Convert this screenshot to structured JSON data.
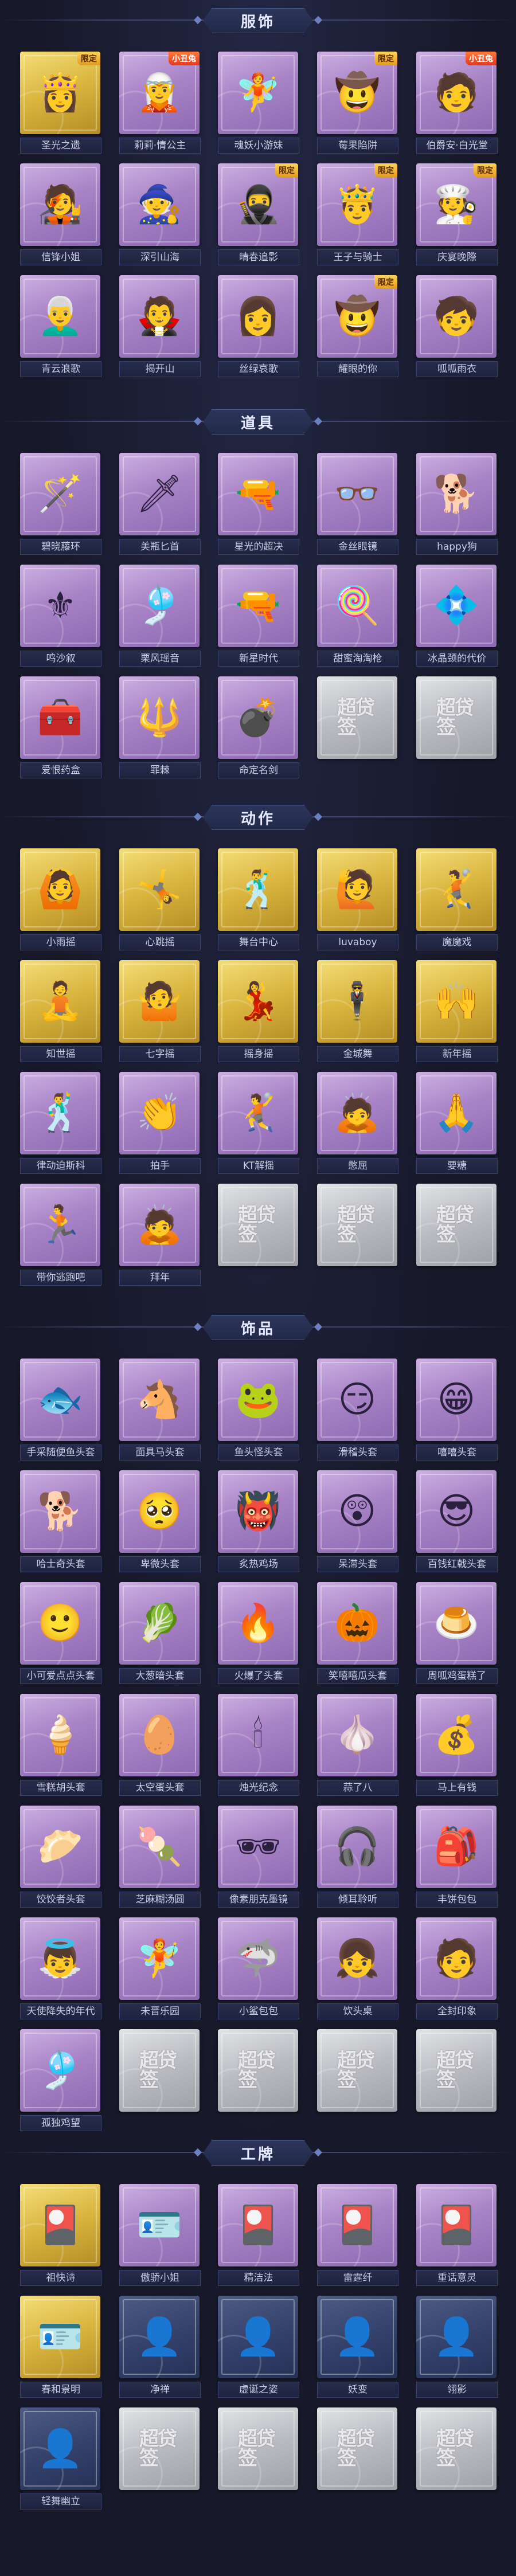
{
  "sections": [
    {
      "id": "clothing",
      "title": "服饰",
      "items": [
        {
          "name": "圣光之遗",
          "style": "gold",
          "icon": "character-portrait-icon",
          "art": "👸",
          "badge": "限定"
        },
        {
          "name": "莉莉·情公主",
          "style": "purple",
          "icon": "character-portrait-icon",
          "art": "🧝",
          "badge": "小丑兔"
        },
        {
          "name": "魂妖小游妹",
          "style": "purple",
          "icon": "character-portrait-icon",
          "art": "🧚"
        },
        {
          "name": "莓果陷阱",
          "style": "purple",
          "icon": "character-portrait-icon",
          "art": "🤠",
          "badge": "限定"
        },
        {
          "name": "伯爵安·白光堂",
          "style": "purple",
          "icon": "character-portrait-icon",
          "art": "🧑",
          "badge": "小丑兔"
        },
        {
          "name": "信锋小姐",
          "style": "purple",
          "icon": "character-portrait-icon",
          "art": "🧑‍🎤"
        },
        {
          "name": "深引山海",
          "style": "purple",
          "icon": "character-portrait-icon",
          "art": "🧙"
        },
        {
          "name": "晴春追影",
          "style": "purple",
          "icon": "character-portrait-icon",
          "art": "🥷",
          "badge": "限定"
        },
        {
          "name": "王子与骑士",
          "style": "purple",
          "icon": "character-portrait-icon",
          "art": "🤴",
          "badge": "限定"
        },
        {
          "name": "庆宴晚際",
          "style": "purple",
          "icon": "character-portrait-icon",
          "art": "🧑‍🍳",
          "badge": "限定"
        },
        {
          "name": "青云浪歌",
          "style": "purple",
          "icon": "character-portrait-icon",
          "art": "👨‍🦳"
        },
        {
          "name": "揭开山",
          "style": "purple",
          "icon": "character-portrait-icon",
          "art": "🧛"
        },
        {
          "name": "丝绿哀歌",
          "style": "purple",
          "icon": "character-portrait-icon",
          "art": "👩"
        },
        {
          "name": "耀眼的你",
          "style": "purple",
          "icon": "character-portrait-icon",
          "art": "🤠",
          "badge": "限定"
        },
        {
          "name": "呱呱雨衣",
          "style": "purple",
          "icon": "character-portrait-icon",
          "art": "🧒"
        }
      ]
    },
    {
      "id": "props",
      "title": "道具",
      "items": [
        {
          "name": "碧晓藤环",
          "style": "purple",
          "icon": "staff-icon",
          "art": "🪄"
        },
        {
          "name": "美瓶匕首",
          "style": "purple",
          "icon": "dagger-icon",
          "art": "🗡"
        },
        {
          "name": "星光的超决",
          "style": "purple",
          "icon": "gun-icon",
          "art": "🔫"
        },
        {
          "name": "金丝眼镜",
          "style": "purple",
          "icon": "glasses-icon",
          "art": "👓"
        },
        {
          "name": "happy狗",
          "style": "purple",
          "icon": "dog-icon",
          "art": "🐕"
        },
        {
          "name": "鸣沙叙",
          "style": "purple",
          "icon": "sceptre-icon",
          "art": "⚜"
        },
        {
          "name": "栗风瑶音",
          "style": "purple",
          "icon": "music-box-icon",
          "art": "🎐"
        },
        {
          "name": "新星时代",
          "style": "purple",
          "icon": "pistol-icon",
          "art": "🔫"
        },
        {
          "name": "甜蜜淘淘枪",
          "style": "purple",
          "icon": "candy-gun-icon",
          "art": "🍭"
        },
        {
          "name": "冰晶颈的代价",
          "style": "purple",
          "icon": "crystal-icon",
          "art": "💠"
        },
        {
          "name": "爱恨药盒",
          "style": "purple",
          "icon": "first-aid-icon",
          "art": "🧰"
        },
        {
          "name": "罪棘",
          "style": "purple",
          "icon": "spear-icon",
          "art": "🔱"
        },
        {
          "name": "命定名剑",
          "style": "purple",
          "icon": "grenade-icon",
          "art": "💣"
        },
        {
          "name": "",
          "style": "empty",
          "icon": "placeholder-icon",
          "art": "超贷签"
        },
        {
          "name": "",
          "style": "empty",
          "icon": "placeholder-icon",
          "art": "超贷签"
        }
      ]
    },
    {
      "id": "actions",
      "title": "动作",
      "items": [
        {
          "name": "小雨摇",
          "style": "gold",
          "icon": "pose-icon",
          "art": "🙆"
        },
        {
          "name": "心跳摇",
          "style": "gold",
          "icon": "pose-icon",
          "art": "🤸"
        },
        {
          "name": "舞台中心",
          "style": "gold",
          "icon": "pose-icon",
          "art": "🕺"
        },
        {
          "name": "luvaboy",
          "style": "gold",
          "icon": "pose-icon",
          "art": "🙋"
        },
        {
          "name": "魔魔戏",
          "style": "gold",
          "icon": "pose-icon",
          "art": "🤾"
        },
        {
          "name": "知世摇",
          "style": "gold",
          "icon": "pose-icon",
          "art": "🧘"
        },
        {
          "name": "七字摇",
          "style": "gold",
          "icon": "pose-icon",
          "art": "🤷"
        },
        {
          "name": "摇身摇",
          "style": "gold",
          "icon": "pose-icon",
          "art": "💃"
        },
        {
          "name": "金城舞",
          "style": "gold",
          "icon": "pose-icon",
          "art": "🕴"
        },
        {
          "name": "新年摇",
          "style": "gold",
          "icon": "pose-icon",
          "art": "🙌"
        },
        {
          "name": "律动迫斯科",
          "style": "purple",
          "icon": "pose-icon",
          "art": "🕺"
        },
        {
          "name": "拍手",
          "style": "purple",
          "icon": "pose-icon",
          "art": "👏"
        },
        {
          "name": "KT解摇",
          "style": "purple",
          "icon": "pose-icon",
          "art": "🤾"
        },
        {
          "name": "憋屈",
          "style": "purple",
          "icon": "pose-icon",
          "art": "🙇"
        },
        {
          "name": "要糖",
          "style": "purple",
          "icon": "pose-icon",
          "art": "🙏"
        },
        {
          "name": "带你逃跑吧",
          "style": "purple",
          "icon": "pose-icon",
          "art": "🏃"
        },
        {
          "name": "拜年",
          "style": "purple",
          "icon": "pose-icon",
          "art": "🙇"
        },
        {
          "name": "",
          "style": "empty",
          "icon": "placeholder-icon",
          "art": "超贷签"
        },
        {
          "name": "",
          "style": "empty",
          "icon": "placeholder-icon",
          "art": "超贷签"
        },
        {
          "name": "",
          "style": "empty",
          "icon": "placeholder-icon",
          "art": "超贷签"
        }
      ]
    },
    {
      "id": "accessories",
      "title": "饰品",
      "items": [
        {
          "name": "手采随便鱼头套",
          "style": "purple",
          "icon": "fish-head-icon",
          "art": "🐟"
        },
        {
          "name": "面具马头套",
          "style": "purple",
          "icon": "horse-head-icon",
          "art": "🐴"
        },
        {
          "name": "鱼头怪头套",
          "style": "purple",
          "icon": "fish-monster-icon",
          "art": "🐸"
        },
        {
          "name": "滑稽头套",
          "style": "purple",
          "icon": "grin-face-icon",
          "art": "😏"
        },
        {
          "name": "嘻嘻头套",
          "style": "purple",
          "icon": "grin-face-icon",
          "art": "😁"
        },
        {
          "name": "哈士奇头套",
          "style": "purple",
          "icon": "husky-head-icon",
          "art": "🐕"
        },
        {
          "name": "卑微头套",
          "style": "purple",
          "icon": "sad-face-icon",
          "art": "🥺"
        },
        {
          "name": "炙热鸡场",
          "style": "purple",
          "icon": "monster-head-icon",
          "art": "👹"
        },
        {
          "name": "呆滞头套",
          "style": "purple",
          "icon": "dazed-face-icon",
          "art": "😲"
        },
        {
          "name": "百钱红戟头套",
          "style": "purple",
          "icon": "pikachu-head-icon",
          "art": "😎"
        },
        {
          "name": "小可爱点点头套",
          "style": "purple",
          "icon": "blob-head-icon",
          "art": "🙂"
        },
        {
          "name": "大葱暗头套",
          "style": "purple",
          "icon": "onion-head-icon",
          "art": "🥬"
        },
        {
          "name": "火爆了头套",
          "style": "purple",
          "icon": "fire-head-icon",
          "art": "🔥"
        },
        {
          "name": "笑嘻嘻瓜头套",
          "style": "purple",
          "icon": "pumpkin-head-icon",
          "art": "🎃"
        },
        {
          "name": "周呱鸡蛋糕了",
          "style": "purple",
          "icon": "pudding-head-icon",
          "art": "🍮"
        },
        {
          "name": "雪糕胡头套",
          "style": "purple",
          "icon": "icecream-head-icon",
          "art": "🍦"
        },
        {
          "name": "太空蛋头套",
          "style": "purple",
          "icon": "egg-head-icon",
          "art": "🥚"
        },
        {
          "name": "烛光纪念",
          "style": "purple",
          "icon": "candle-head-icon",
          "art": "🕯"
        },
        {
          "name": "蒜了八",
          "style": "purple",
          "icon": "garlic-head-icon",
          "art": "🧄"
        },
        {
          "name": "马上有钱",
          "style": "purple",
          "icon": "money-head-icon",
          "art": "💰"
        },
        {
          "name": "饺饺者头套",
          "style": "purple",
          "icon": "dumpling-head-icon",
          "art": "🥟"
        },
        {
          "name": "芝麻糊汤圆",
          "style": "purple",
          "icon": "dumpling-head-icon",
          "art": "🍡"
        },
        {
          "name": "像素朋克墨镜",
          "style": "purple",
          "icon": "pixel-glasses-icon",
          "art": "🕶"
        },
        {
          "name": "倾耳聆听",
          "style": "purple",
          "icon": "headphone-icon",
          "art": "🎧"
        },
        {
          "name": "丰饼包包",
          "style": "purple",
          "icon": "bag-icon",
          "art": "🎒"
        },
        {
          "name": "天使降失的年代",
          "style": "purple",
          "icon": "angel-icon",
          "art": "👼"
        },
        {
          "name": "未晋乐园",
          "style": "purple",
          "icon": "girl-doll-icon",
          "art": "🧚"
        },
        {
          "name": "小鲨包包",
          "style": "purple",
          "icon": "shark-bag-icon",
          "art": "🦈"
        },
        {
          "name": "饮头桌",
          "style": "purple",
          "icon": "girl-doll-icon",
          "art": "👧"
        },
        {
          "name": "全封印象",
          "style": "purple",
          "icon": "character-doll-icon",
          "art": "🧑"
        },
        {
          "name": "孤独鸡望",
          "style": "purple",
          "icon": "wind-chime-icon",
          "art": "🎐"
        },
        {
          "name": "",
          "style": "empty",
          "icon": "placeholder-icon",
          "art": "超贷签"
        },
        {
          "name": "",
          "style": "empty",
          "icon": "placeholder-icon",
          "art": "超贷签"
        },
        {
          "name": "",
          "style": "empty",
          "icon": "placeholder-icon",
          "art": "超贷签"
        },
        {
          "name": "",
          "style": "empty",
          "icon": "placeholder-icon",
          "art": "超贷签"
        }
      ]
    },
    {
      "id": "badges",
      "title": "工牌",
      "items": [
        {
          "name": "祖快诗",
          "style": "gold",
          "icon": "id-card-icon",
          "art": "🎴"
        },
        {
          "name": "傲骄小姐",
          "style": "purple",
          "icon": "id-card-icon",
          "art": "🪪"
        },
        {
          "name": "精洁法",
          "style": "purple",
          "icon": "id-card-icon",
          "art": "🎴"
        },
        {
          "name": "雷霆纤",
          "style": "purple",
          "icon": "id-card-icon",
          "art": "🎴"
        },
        {
          "name": "重话意灵",
          "style": "purple",
          "icon": "id-card-icon",
          "art": "🎴"
        },
        {
          "name": "春和景明",
          "style": "gold",
          "icon": "id-card-icon",
          "art": "🪪"
        },
        {
          "name": "净禅",
          "style": "navy",
          "icon": "silhouette-icon",
          "art": "👤"
        },
        {
          "name": "虚诞之姿",
          "style": "navy",
          "icon": "silhouette-icon",
          "art": "👤"
        },
        {
          "name": "妖变",
          "style": "navy",
          "icon": "silhouette-icon",
          "art": "👤"
        },
        {
          "name": "翎影",
          "style": "navy",
          "icon": "silhouette-icon",
          "art": "👤"
        },
        {
          "name": "轻舞幽立",
          "style": "navy",
          "icon": "silhouette-icon",
          "art": "👤"
        },
        {
          "name": "",
          "style": "empty",
          "icon": "placeholder-icon",
          "art": "超贷签"
        },
        {
          "name": "",
          "style": "empty",
          "icon": "placeholder-icon",
          "art": "超贷签"
        },
        {
          "name": "",
          "style": "empty",
          "icon": "placeholder-icon",
          "art": "超贷签"
        },
        {
          "name": "",
          "style": "empty",
          "icon": "placeholder-icon",
          "art": "超贷签"
        }
      ]
    }
  ]
}
